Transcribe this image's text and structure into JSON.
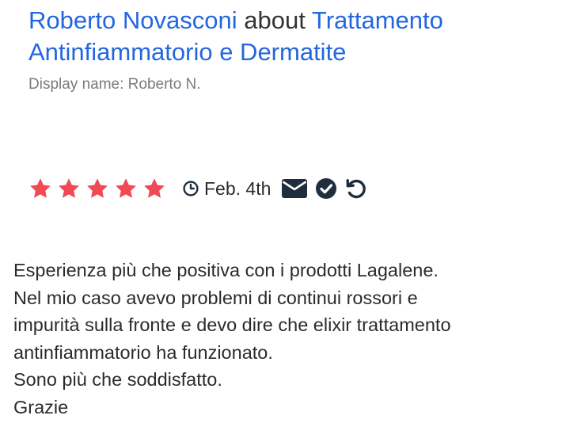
{
  "review": {
    "author": "Roberto Novasconi",
    "about_word": "about",
    "product": "Trattamento Antinfiammatorio e Dermatite",
    "display_name": "Display name: Roberto N.",
    "rating": 5,
    "rating_max": 5,
    "date": "Feb. 4th",
    "status_icons": [
      "envelope-icon",
      "verified-check-icon",
      "refresh-icon"
    ],
    "body_lines": [
      "Esperienza più che positiva con i prodotti Lagalene.",
      "Nel mio caso avevo problemi di continui rossori e",
      "impurità sulla fronte e devo dire che elixir trattamento",
      "antinfiammatorio ha funzionato.",
      "Sono più che soddisfatto.",
      "Grazie"
    ]
  },
  "colors": {
    "link": "#2466e0",
    "star": "#f04a54",
    "muted": "#7b7b7b",
    "icon": "#1f2d3d"
  }
}
